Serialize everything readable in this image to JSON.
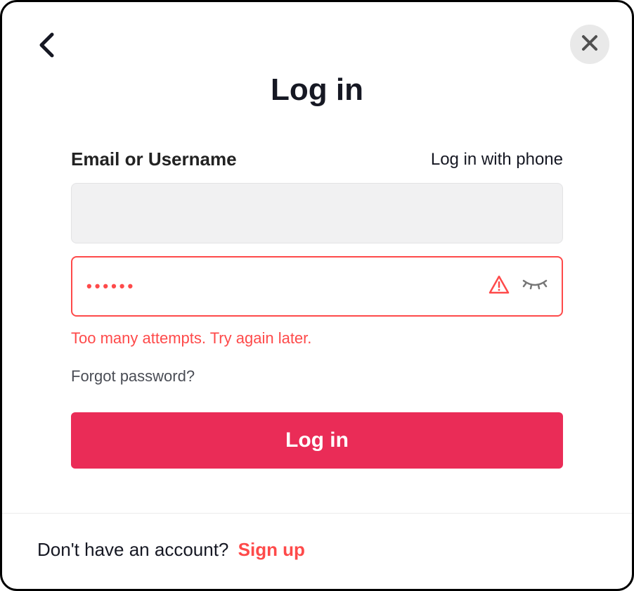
{
  "header": {
    "title": "Log in"
  },
  "form": {
    "username_label": "Email or Username",
    "phone_link": "Log in with phone",
    "username_value": "",
    "password_value": "••••••",
    "error_message": "Too many attempts. Try again later.",
    "forgot_label": "Forgot password?",
    "login_button": "Log in"
  },
  "footer": {
    "prompt": "Don't have an account?",
    "signup_label": "Sign up"
  }
}
